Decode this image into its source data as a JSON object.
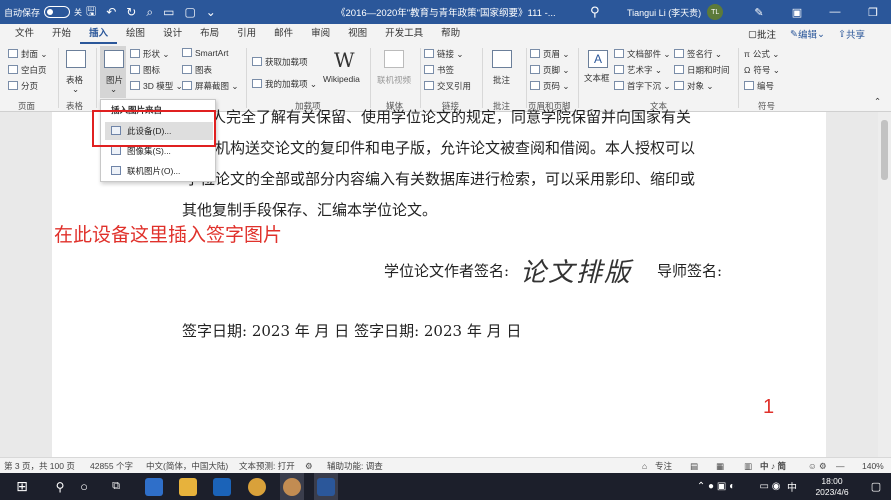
{
  "titlebar": {
    "autosave_label": "自动保存",
    "toggle_state": "关",
    "doc_title": "《2016—2020年\"教育与青年政策\"国家纲要》111 -...",
    "user_name": "Tiangui Li (李天贵)",
    "user_initials": "TL"
  },
  "tabs": [
    "文件",
    "开始",
    "插入",
    "绘图",
    "设计",
    "布局",
    "引用",
    "邮件",
    "审阅",
    "视图",
    "开发工具",
    "帮助"
  ],
  "tabs_right": {
    "comments": "批注",
    "edit": "编辑",
    "share": "共享"
  },
  "ribbon": {
    "cover": "封面",
    "blank_page": "空白页",
    "page_break": "分页",
    "group_pages": "页面",
    "table": "表格",
    "group_table": "表格",
    "picture": "图片",
    "shapes": "形状",
    "icons": "图标",
    "model3d": "3D 模型",
    "smartart": "SmartArt",
    "chart": "图表",
    "screenshot": "屏幕截图",
    "get_addins": "获取加载项",
    "my_addins": "我的加载项",
    "wikipedia": "Wikipedia",
    "group_addins": "加载项",
    "online_video": "联机视频",
    "group_media": "媒体",
    "link": "链接",
    "bookmark": "书签",
    "cross_ref": "交叉引用",
    "group_links": "链接",
    "comment": "批注",
    "group_comments": "批注",
    "header": "页眉",
    "footer": "页脚",
    "page_number": "页码",
    "group_header_footer": "页眉和页脚",
    "textbox": "文本框",
    "doc_parts": "文档部件",
    "wordart": "艺术字",
    "dropcap": "首字下沉",
    "signature_line": "签名行",
    "date_time": "日期和时间",
    "object": "对象",
    "group_text": "文本",
    "equation": "公式",
    "symbol": "符号",
    "numbering": "编号",
    "group_symbols": "符号"
  },
  "picture_menu": {
    "header": "插入图片来自",
    "items": [
      "此设备(D)...",
      "图像集(S)...",
      "联机图片(O)..."
    ]
  },
  "document": {
    "line1": "本人完全了解有关保留、使用学位论文的规定，同意学院保留并向国家有关",
    "line2": "门或机构送交论文的复印件和电子版，允许论文被查阅和借阅。本人授权可以",
    "line3": "学位论文的全部或部分内容编入有关数据库进行检索，可以采用影印、缩印或",
    "line4": "其他复制手段保存、汇编本学位论文。",
    "annotation": "在此设备这里插入签字图片",
    "author_sign_label": "学位论文作者签名:",
    "signature_text": "论文排版",
    "advisor_sign_label": "导师签名:",
    "date_line": "签字日期:   2023   年      月      日            签字日期:   2023   年      月      日",
    "page_marker": "1"
  },
  "statusbar": {
    "page": "第 3 页，共 100 页",
    "words": "42855 个字",
    "language": "中文(简体，中国大陆)",
    "text_predict": "文本预测: 打开",
    "accessibility": "辅助功能: 调查",
    "focus": "专注",
    "zoom": "140%"
  },
  "taskbar": {
    "ime": "中",
    "ime_bar": "中 ♪ 简",
    "time": "18:00",
    "date": "2023/4/6"
  },
  "colors": {
    "accent": "#2b579a",
    "red": "#e0312b"
  }
}
